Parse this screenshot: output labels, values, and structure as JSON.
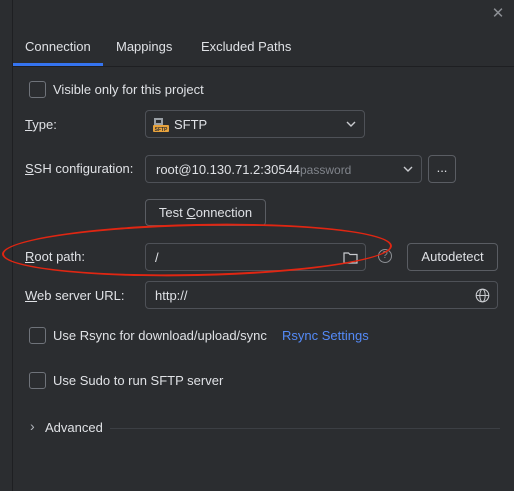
{
  "window": {
    "close_glyph": "✕"
  },
  "tabs": [
    {
      "label": "Connection",
      "active": true
    },
    {
      "label": "Mappings",
      "active": false
    },
    {
      "label": "Excluded Paths",
      "active": false
    }
  ],
  "visible_only": {
    "label": "Visible only for this project",
    "checked": false
  },
  "type": {
    "label_first": "T",
    "label_rest": "ype:",
    "value": "SFTP",
    "icon": "sftp-icon"
  },
  "ssh": {
    "label_first": "S",
    "label_rest": "SH configuration:",
    "value": "root@10.130.71.2:30544",
    "auth": "password",
    "more": "..."
  },
  "test_connection": {
    "label_pre": "Test ",
    "label_u": "C",
    "label_post": "onnection"
  },
  "root_path": {
    "label_first": "R",
    "label_rest": "oot path:",
    "value": "/",
    "help": "?",
    "autodetect": "Autodetect"
  },
  "web_url": {
    "label_first": "W",
    "label_rest": "eb server URL:",
    "value": "http://"
  },
  "rsync": {
    "label": "Use Rsync for download/upload/sync",
    "link": "Rsync Settings",
    "checked": false
  },
  "sudo": {
    "label": "Use Sudo to run SFTP server",
    "checked": false
  },
  "advanced": {
    "label": "Advanced",
    "chevron": "›"
  },
  "colors": {
    "accent": "#3574f0",
    "link": "#548af7",
    "annotation": "#e02612",
    "background": "#2b2d30"
  }
}
